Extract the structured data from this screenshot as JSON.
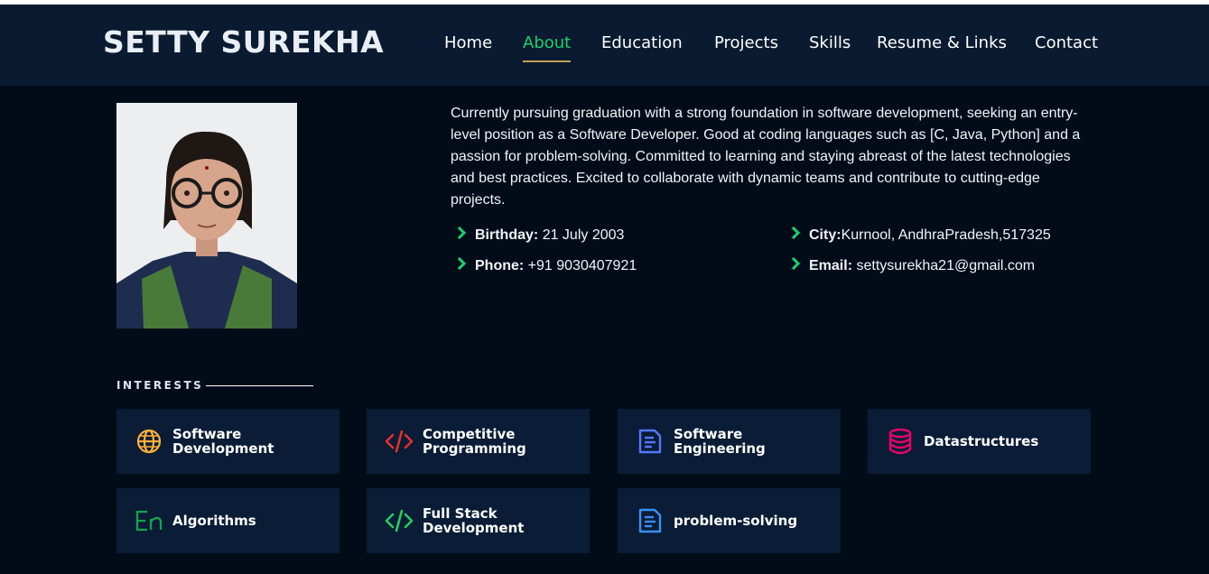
{
  "header": {
    "logo": "SETTY SUREKHA",
    "nav": [
      "Home",
      "About",
      "Education",
      "Projects",
      "Skills",
      "Resume & Links",
      "Contact"
    ],
    "active": "About"
  },
  "about": {
    "paragraph": "Currently pursuing graduation with a strong foundation in software development, seeking an entry-level position as a Software Developer. Good at coding languages such as [C, Java, Python] and a passion for problem-solving. Committed to learning and staying abreast of the latest technologies and best practices. Excited to collaborate with dynamic teams and contribute to cutting-edge projects.",
    "birthday_label": "Birthday:",
    "birthday": "21 July 2003",
    "city_label": "City:",
    "city": "Kurnool, AndhraPradesh,517325",
    "phone_label": "Phone:",
    "phone": "+91 9030407921",
    "email_label": "Email:",
    "email": "settysurekha21@gmail.com"
  },
  "interests": {
    "title": "INTERESTS",
    "items": [
      {
        "label": "Software Development",
        "icon": "globe-icon",
        "color": "#ffb03b"
      },
      {
        "label": "Competitive Programming",
        "icon": "code-icon",
        "color": "#e2322c"
      },
      {
        "label": "Software Engineering",
        "icon": "document-icon",
        "color": "#5578ff"
      },
      {
        "label": "Datastructures",
        "icon": "database-icon",
        "color": "#e80368"
      },
      {
        "label": "Algorithms",
        "icon": "language-icon",
        "color": "#11a64c"
      },
      {
        "label": "Full Stack Development",
        "icon": "code-icon",
        "color": "#29cc61"
      },
      {
        "label": "problem-solving",
        "icon": "document-icon",
        "color": "#3a8ff5"
      }
    ]
  },
  "colors": {
    "accent": "#18d26e",
    "header_bg": "#0a1a30",
    "page_bg": "#020c18",
    "card_bg": "#0a1c36"
  }
}
